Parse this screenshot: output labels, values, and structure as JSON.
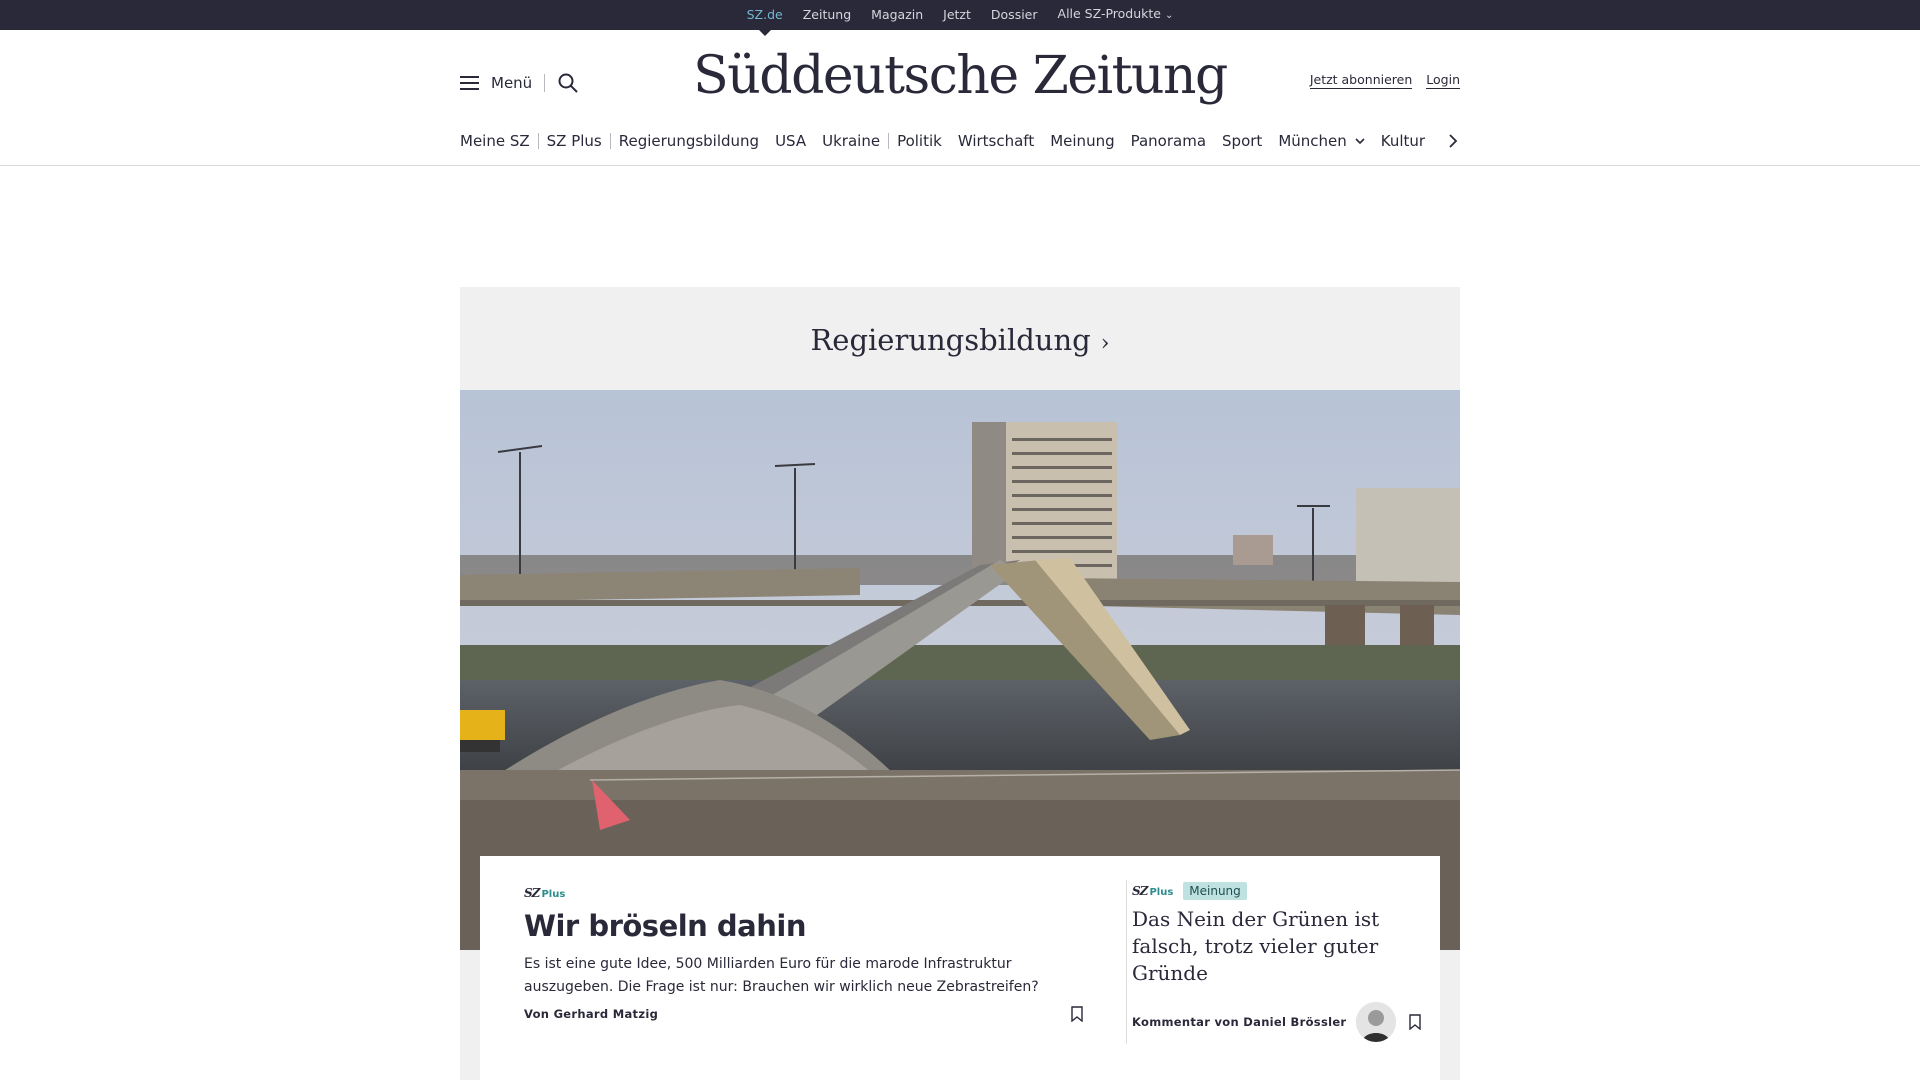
{
  "topbar": {
    "items": [
      "SZ.de",
      "Zeitung",
      "Magazin",
      "Jetzt",
      "Dossier",
      "Alle SZ-Produkte"
    ]
  },
  "header": {
    "menu_label": "Menü",
    "logo": "Süddeutsche Zeitung",
    "subscribe": "Jetzt abonnieren",
    "login": "Login"
  },
  "nav": {
    "items": [
      "Meine SZ",
      "SZ Plus",
      "Regierungsbildung",
      "USA",
      "Ukraine",
      "Politik",
      "Wirtschaft",
      "Meinung",
      "Panorama",
      "Sport",
      "München",
      "Kultur"
    ]
  },
  "section": {
    "title": "Regierungsbildung"
  },
  "main_teaser": {
    "brand": "SZ",
    "brand_plus": "Plus",
    "headline": "Wir bröseln dahin",
    "text": "Es ist eine gute Idee, 500 Milliarden Euro für die marode Infrastruktur auszugeben. Die Frage ist nur:  Brauchen wir wirklich neue Zebrastreifen?",
    "byline": "Von Gerhard Matzig"
  },
  "side_teaser": {
    "brand": "SZ",
    "brand_plus": "Plus",
    "badge": "Meinung",
    "headline": "Das Nein der Grünen ist falsch, trotz vieler guter Gründe",
    "byline": "Kommentar von Daniel Brössler"
  },
  "colors": {
    "topbar_bg": "#29293a",
    "accent": "#73b7d0",
    "badge_bg": "#bfe2e0",
    "section_bg": "#f0f0f0"
  }
}
